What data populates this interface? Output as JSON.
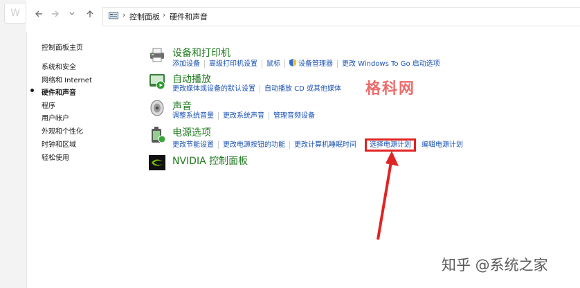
{
  "window": {
    "ghost_tab_letter": "W"
  },
  "nav": {
    "back_icon": "arrow-left",
    "forward_icon": "arrow-right",
    "recent_icon": "chevron-down",
    "up_icon": "arrow-up"
  },
  "breadcrumb": {
    "root": "控制面板",
    "current": "硬件和声音",
    "separator": "›"
  },
  "sidebar": {
    "home": "控制面板主页",
    "items": [
      {
        "label": "系统和安全"
      },
      {
        "label": "网络和 Internet"
      },
      {
        "label": "硬件和声音",
        "current": true
      },
      {
        "label": "程序"
      },
      {
        "label": "用户帐户"
      },
      {
        "label": "外观和个性化"
      },
      {
        "label": "时钟和区域"
      },
      {
        "label": "轻松使用"
      }
    ]
  },
  "categories": [
    {
      "title": "设备和打印机",
      "icon": "printer-icon",
      "links": [
        "添加设备",
        "高级打印机设置",
        "鼠标",
        "设备管理器",
        "更改 Windows To Go 启动选项"
      ]
    },
    {
      "title": "自动播放",
      "icon": "autoplay-icon",
      "links": [
        "更改媒体或设备的默认设置",
        "自动播放 CD 或其他媒体"
      ]
    },
    {
      "title": "声音",
      "icon": "speaker-icon",
      "links": [
        "调整系统音量",
        "更改系统声音",
        "管理音频设备"
      ]
    },
    {
      "title": "电源选项",
      "icon": "power-icon",
      "links": [
        "更改节能设置",
        "更改电源按钮的功能",
        "更改计算机睡眠时间",
        "选择电源计划",
        "编辑电源计划"
      ],
      "highlighted_link": "选择电源计划"
    },
    {
      "title": "NVIDIA 控制面板",
      "icon": "nvidia-icon",
      "links": []
    }
  ],
  "annotations": {
    "watermark": "格科网",
    "footer": "知乎 @系统之家",
    "highlight_color": "#e02424"
  }
}
